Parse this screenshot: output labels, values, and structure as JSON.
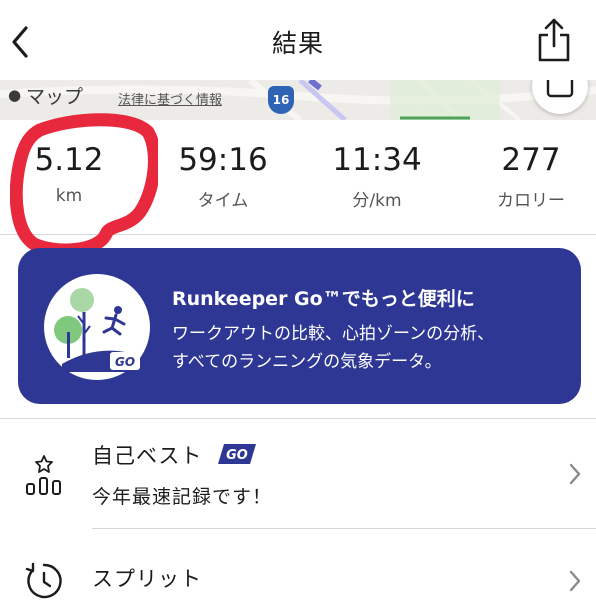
{
  "nav": {
    "title": "結果"
  },
  "map": {
    "attribution": "マップ",
    "legal_link": "法律に基づく情報",
    "route_number": "16"
  },
  "stats": [
    {
      "value": "5.12",
      "unit": "km"
    },
    {
      "value": "59:16",
      "unit": "タイム"
    },
    {
      "value": "11:34",
      "unit": "分/km"
    },
    {
      "value": "277",
      "unit": "カロリー"
    }
  ],
  "promo": {
    "headline": "Runkeeper Go™でもっと便利に",
    "body_line1": "ワークアウトの比較、心拍ゾーンの分析、",
    "body_line2": "すべてのランニングの気象データ。",
    "badge": "GO"
  },
  "personal_best": {
    "title": "自己ベスト",
    "badge": "GO",
    "subtitle": "今年最速記録です！"
  },
  "splits": {
    "title": "スプリット"
  },
  "colors": {
    "brand": "#2e3793",
    "highlight_circle": "#e8283c"
  }
}
